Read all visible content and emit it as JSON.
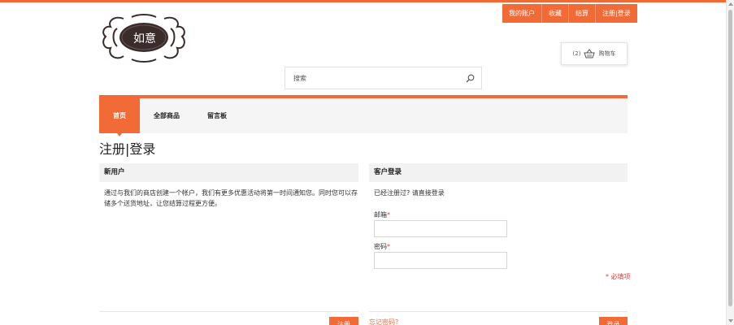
{
  "header": {
    "top_links": [
      "我的账户",
      "收藏",
      "结算",
      "注册|登录"
    ],
    "logo_text": "如意",
    "cart": {
      "count_text": "(2)",
      "label": "购物车"
    },
    "search": {
      "placeholder": "搜索"
    }
  },
  "nav": {
    "items": [
      {
        "label": "首页",
        "active": true
      },
      {
        "label": "全部商品",
        "active": false
      },
      {
        "label": "留言板",
        "active": false
      }
    ]
  },
  "page": {
    "title": "注册|登录",
    "new_user": {
      "heading": "新用户",
      "description": "通过与我们的商店创建一个帐户，我们有更多优惠活动将第一时间通知您。同时您可以存储多个送货地址，让您结算过程更方便。",
      "button_label": "注册"
    },
    "customer_login": {
      "heading": "客户登录",
      "description": "已经注册过? 请直接登录",
      "email_label": "邮箱",
      "password_label": "密码",
      "required_mark": "*",
      "required_note": "* 必填项",
      "forgot_link": "忘记密码?",
      "login_button": "登录"
    }
  },
  "colors": {
    "accent": "#f26a36",
    "required": "#e63b3b"
  }
}
